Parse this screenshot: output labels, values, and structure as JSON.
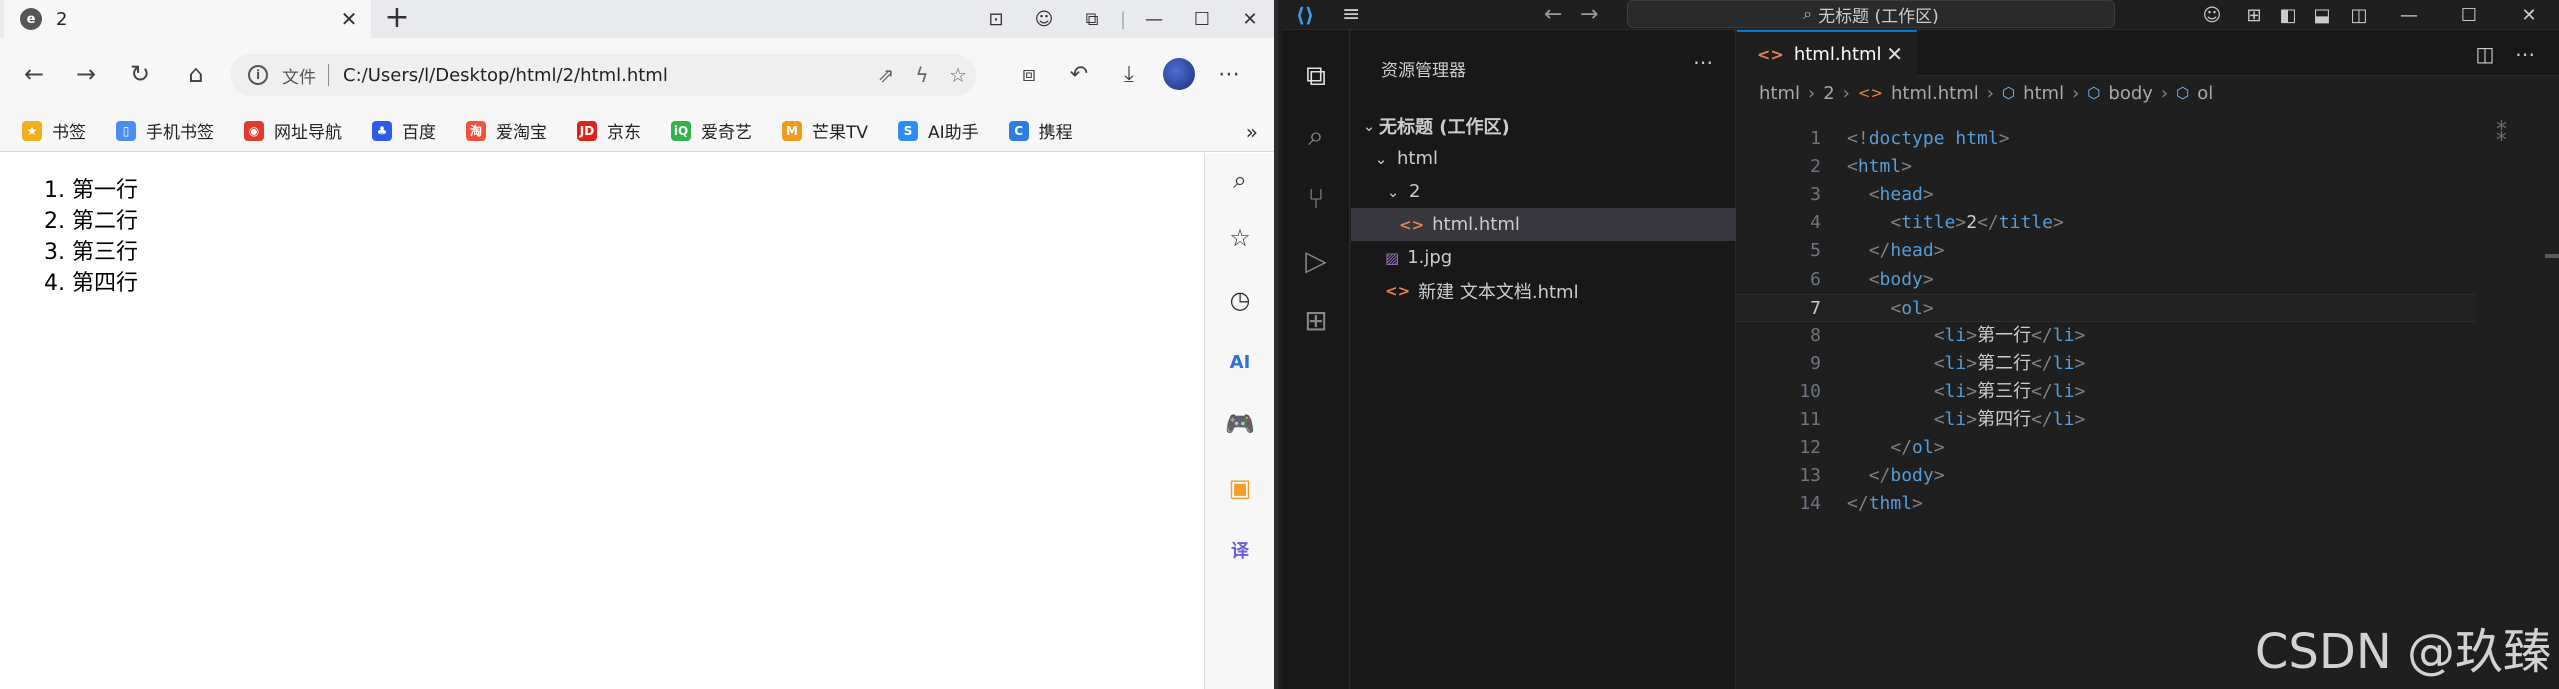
{
  "browser": {
    "tab": {
      "title": "2",
      "favicon": "edge-icon"
    },
    "window_controls": [
      "—",
      "☐",
      "✕"
    ],
    "address": {
      "label": "文件",
      "url": "C:/Users/l/Desktop/html/2/html.html"
    },
    "bookmarks": [
      {
        "label": "书签",
        "icon": "star-icon",
        "color": "#f2b01e"
      },
      {
        "label": "手机书签",
        "icon": "phone-icon",
        "color": "#4a8ef0"
      },
      {
        "label": "网址导航",
        "icon": "weibo-icon",
        "color": "#e23b2e"
      },
      {
        "label": "百度",
        "icon": "baidu-icon",
        "color": "#2f5bea"
      },
      {
        "label": "爱淘宝",
        "icon": "taobao-icon",
        "color": "#f2503c"
      },
      {
        "label": "京东",
        "icon": "jd-icon",
        "color": "#d9261c"
      },
      {
        "label": "爱奇艺",
        "icon": "iqiyi-icon",
        "color": "#32b24a"
      },
      {
        "label": "芒果TV",
        "icon": "mango-icon",
        "color": "#f39a1e"
      },
      {
        "label": "AI助手",
        "icon": "ai-icon",
        "color": "#2e8ef0"
      },
      {
        "label": "携程",
        "icon": "ctrip-icon",
        "color": "#2f7de0"
      }
    ],
    "page_list": [
      "第一行",
      "第二行",
      "第三行",
      "第四行"
    ]
  },
  "vscode": {
    "command_center": "无标题 (工作区)",
    "explorer": {
      "title": "资源管理器",
      "workspace": "无标题 (工作区)",
      "folder": "html",
      "subfolder": "2",
      "files": {
        "active": "html.html",
        "image": "1.jpg",
        "new_doc": "新建 文本文档.html"
      }
    },
    "tab": {
      "title": "html.html"
    },
    "breadcrumb": [
      "html",
      "2",
      "html.html",
      "html",
      "body",
      "ol"
    ],
    "code": [
      "<!doctype html>",
      "<html>",
      "  <head>",
      "    <title>2</title>",
      "  </head>",
      "  <body>",
      "    <ol>",
      "        <li>第一行</li>",
      "        <li>第二行</li>",
      "        <li>第三行</li>",
      "        <li>第四行</li>",
      "    </ol>",
      "  </body>",
      "</thml>"
    ],
    "line_numbers": [
      "1",
      "2",
      "3",
      "4",
      "5",
      "6",
      "7",
      "8",
      "9",
      "10",
      "11",
      "12",
      "13",
      "14"
    ],
    "current_line": 7,
    "accent": "#0078d4"
  },
  "watermark": "CSDN @玖臻"
}
